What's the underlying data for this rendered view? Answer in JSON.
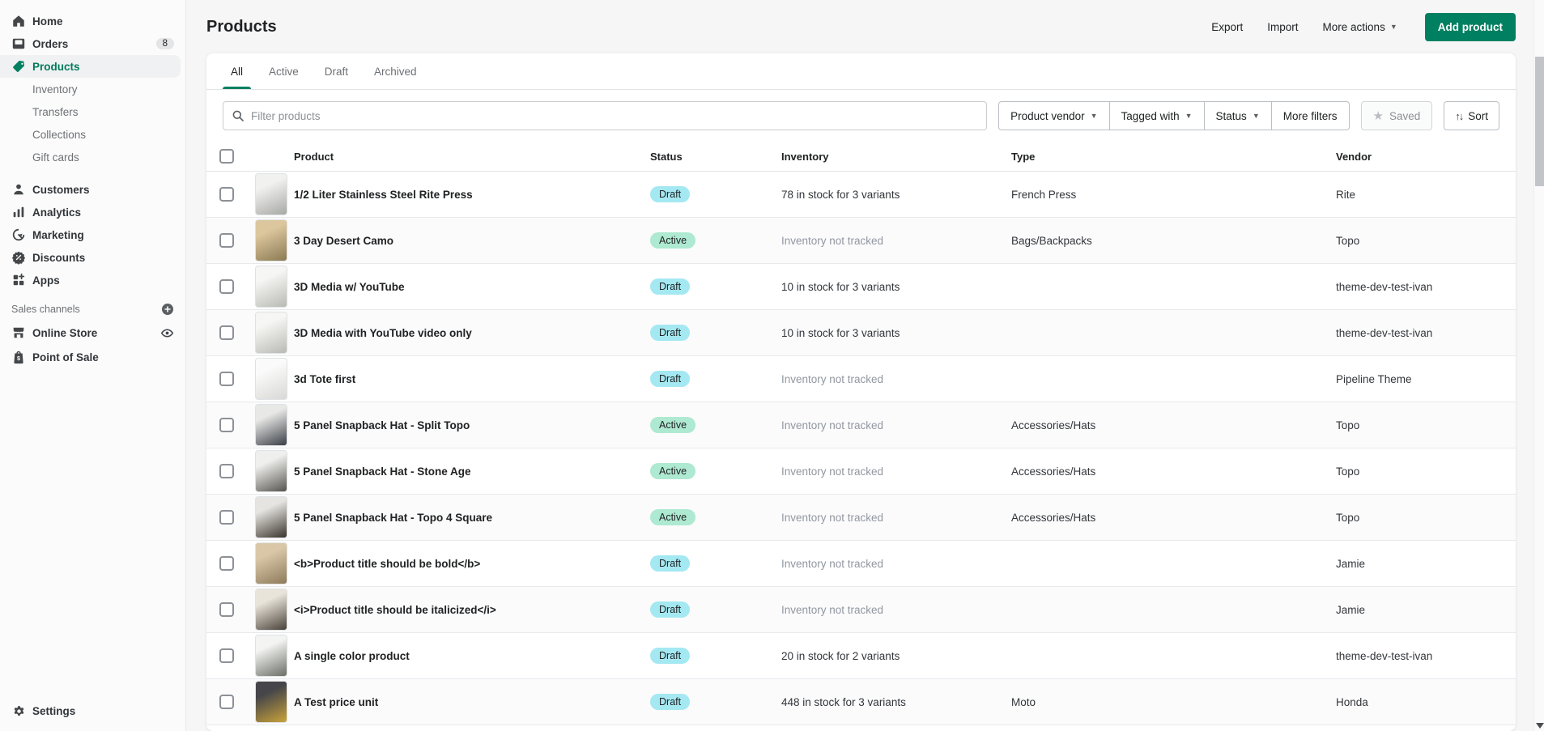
{
  "colors": {
    "accent": "#008060",
    "badge_draft_bg": "#a4e8f2",
    "badge_active_bg": "#aee9d1"
  },
  "sidebar": {
    "items": [
      {
        "label": "Home",
        "icon": "home"
      },
      {
        "label": "Orders",
        "icon": "orders",
        "badge": "8"
      },
      {
        "label": "Products",
        "icon": "products",
        "active": true
      },
      {
        "label": "Inventory",
        "sub": true
      },
      {
        "label": "Transfers",
        "sub": true
      },
      {
        "label": "Collections",
        "sub": true
      },
      {
        "label": "Gift cards",
        "sub": true
      },
      {
        "gap": true
      },
      {
        "label": "Customers",
        "icon": "customers"
      },
      {
        "label": "Analytics",
        "icon": "analytics"
      },
      {
        "label": "Marketing",
        "icon": "marketing"
      },
      {
        "label": "Discounts",
        "icon": "discounts"
      },
      {
        "label": "Apps",
        "icon": "apps"
      }
    ],
    "sales_channels_label": "Sales channels",
    "channels": [
      {
        "label": "Online Store",
        "icon": "store",
        "trailing": "eye"
      },
      {
        "label": "Point of Sale",
        "icon": "pos"
      }
    ],
    "settings_label": "Settings"
  },
  "header": {
    "title": "Products",
    "export_label": "Export",
    "import_label": "Import",
    "more_actions_label": "More actions",
    "add_product_label": "Add product"
  },
  "tabs": [
    {
      "label": "All",
      "active": true
    },
    {
      "label": "Active"
    },
    {
      "label": "Draft"
    },
    {
      "label": "Archived"
    }
  ],
  "filters": {
    "search_placeholder": "Filter products",
    "segments": [
      {
        "label": "Product vendor",
        "caret": true
      },
      {
        "label": "Tagged with",
        "caret": true
      },
      {
        "label": "Status",
        "caret": true
      },
      {
        "label": "More filters",
        "caret": false
      }
    ],
    "saved_label": "Saved",
    "sort_label": "Sort"
  },
  "table": {
    "columns": [
      "Product",
      "Status",
      "Inventory",
      "Type",
      "Vendor"
    ],
    "rows": [
      {
        "title": "1/2 Liter Stainless Steel Rite Press",
        "status": "Draft",
        "inventory": "78 in stock for 3 variants",
        "tracked": true,
        "type": "French Press",
        "vendor": "Rite",
        "thumb": [
          "#f1f1ef",
          "#a8a9a5"
        ]
      },
      {
        "title": "3 Day Desert Camo",
        "status": "Active",
        "inventory": "Inventory not tracked",
        "tracked": false,
        "type": "Bags/Backpacks",
        "vendor": "Topo",
        "thumb": [
          "#dcc69e",
          "#8a7a52"
        ]
      },
      {
        "title": "3D Media w/ YouTube",
        "status": "Draft",
        "inventory": "10 in stock for 3 variants",
        "tracked": true,
        "type": "",
        "vendor": "theme-dev-test-ivan",
        "thumb": [
          "#f6f6f4",
          "#b9b9b4"
        ]
      },
      {
        "title": "3D Media with YouTube video only",
        "status": "Draft",
        "inventory": "10 in stock for 3 variants",
        "tracked": true,
        "type": "",
        "vendor": "theme-dev-test-ivan",
        "thumb": [
          "#f6f6f4",
          "#b9b9b4"
        ]
      },
      {
        "title": "3d Tote first",
        "status": "Draft",
        "inventory": "Inventory not tracked",
        "tracked": false,
        "type": "",
        "vendor": "Pipeline Theme",
        "thumb": [
          "#fafafa",
          "#d8d8d6"
        ]
      },
      {
        "title": "5 Panel Snapback Hat - Split Topo",
        "status": "Active",
        "inventory": "Inventory not tracked",
        "tracked": false,
        "type": "Accessories/Hats",
        "vendor": "Topo",
        "thumb": [
          "#e8e8e6",
          "#3a3e46"
        ]
      },
      {
        "title": "5 Panel Snapback Hat - Stone Age",
        "status": "Active",
        "inventory": "Inventory not tracked",
        "tracked": false,
        "type": "Accessories/Hats",
        "vendor": "Topo",
        "thumb": [
          "#efefed",
          "#55544e"
        ]
      },
      {
        "title": "5 Panel Snapback Hat - Topo 4 Square",
        "status": "Active",
        "inventory": "Inventory not tracked",
        "tracked": false,
        "type": "Accessories/Hats",
        "vendor": "Topo",
        "thumb": [
          "#e6e4e0",
          "#39342c"
        ]
      },
      {
        "title": "<b>Product title should be bold</b>",
        "status": "Draft",
        "inventory": "Inventory not tracked",
        "tracked": false,
        "type": "",
        "vendor": "Jamie",
        "thumb": [
          "#d9c7a8",
          "#8e7b5a"
        ]
      },
      {
        "title": "<i>Product title should be italicized</i>",
        "status": "Draft",
        "inventory": "Inventory not tracked",
        "tracked": false,
        "type": "",
        "vendor": "Jamie",
        "thumb": [
          "#e9e4da",
          "#4a423a"
        ]
      },
      {
        "title": "A single color product",
        "status": "Draft",
        "inventory": "20 in stock for 2 variants",
        "tracked": true,
        "type": "",
        "vendor": "theme-dev-test-ivan",
        "thumb": [
          "#f4f4f2",
          "#6b6f66"
        ]
      },
      {
        "title": "A Test price unit",
        "status": "Draft",
        "inventory": "448 in stock for 3 variants",
        "tracked": true,
        "type": "Moto",
        "vendor": "Honda",
        "thumb": [
          "#46464a",
          "#c9a23a"
        ]
      }
    ]
  }
}
